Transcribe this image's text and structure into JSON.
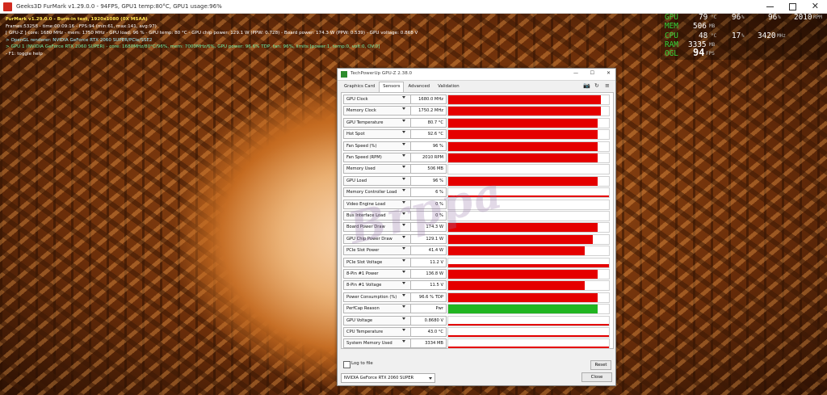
{
  "window": {
    "title": "Geeks3D FurMark v1.29.0.0 - 94FPS, GPU1 temp:80°C, GPU1 usage:96%"
  },
  "overlay": {
    "lines": [
      "FurMark v1.29.0.0 - Burn-in test, 1920x1080 (0X MSAA)",
      "Frames:53258 - time:00:09:16 - FPS:94 (min:61, max:141, avg:97)",
      "[ GPU-Z ] core: 1680 MHz - mem: 1750 MHz - GPU load: 96 % - GPU temp: 80 °C - GPU chip power: 129.1 W (PPW: 0.728) - Board power: 174.3 W (PPW: 0.539) - GPU voltage: 0.868 V",
      "> OpenGL renderer: NVIDIA GeForce RTX 2060 SUPER/PCIe/SSE2",
      "> GPU 1 (NVIDIA GeForce RTX 2060 SUPER) - core: 1680MHz/80°C/96%, mem: 7000MHz/6%, GPU power: 96.6% TDP, fan: 96%, limits:[power:1, temp:0, volt:0, OV:0]",
      "- F1: toggle help"
    ]
  },
  "osd": {
    "rows": [
      {
        "label": "GPU",
        "values": [
          "79",
          "96",
          "96",
          "2010"
        ],
        "units": [
          "°C",
          "%",
          "%",
          "RPM"
        ]
      },
      {
        "label": "MEM",
        "values": [
          "506"
        ],
        "units": [
          "MB"
        ]
      },
      {
        "label": "CPU",
        "values": [
          "48",
          "17",
          "3420"
        ],
        "units": [
          "°C",
          "%",
          "MHz"
        ]
      },
      {
        "label": "RAM",
        "values": [
          "3335"
        ],
        "units": [
          "MB"
        ]
      },
      {
        "label": "OGL",
        "values": [
          "94"
        ],
        "units": [
          "FPS"
        ]
      }
    ]
  },
  "gpuz": {
    "title": "TechPowerUp GPU-Z 2.38.0",
    "tabs": [
      "Graphics Card",
      "Sensors",
      "Advanced",
      "Validation"
    ],
    "active_tab": "Sensors",
    "sensors": [
      {
        "name": "GPU Clock",
        "value": "1680.0 MHz",
        "level": 0.95,
        "color": "#e50000"
      },
      {
        "name": "Memory Clock",
        "value": "1750.2 MHz",
        "level": 0.95,
        "color": "#e50000"
      },
      {
        "name": "GPU Temperature",
        "value": "80.7 °C",
        "level": 0.93,
        "color": "#e50000"
      },
      {
        "name": "Hot Spot",
        "value": "92.6 °C",
        "level": 0.93,
        "color": "#e50000"
      },
      {
        "name": "Fan Speed (%)",
        "value": "96 %",
        "level": 0.93,
        "color": "#e50000"
      },
      {
        "name": "Fan Speed (RPM)",
        "value": "2010 RPM",
        "level": 0.93,
        "color": "#e50000"
      },
      {
        "name": "Memory Used",
        "value": "506 MB",
        "level": 0.0,
        "color": "#e50000"
      },
      {
        "name": "GPU Load",
        "value": "96 %",
        "level": 0.93,
        "color": "#e50000"
      },
      {
        "name": "Memory Controller Load",
        "value": "6 %",
        "level": 0.12,
        "color": "#e50000"
      },
      {
        "name": "Video Engine Load",
        "value": "0 %",
        "level": 0.0,
        "color": "#e50000"
      },
      {
        "name": "Bus Interface Load",
        "value": "0 %",
        "level": 0.0,
        "color": "#e50000"
      },
      {
        "name": "Board Power Draw",
        "value": "174.3 W",
        "level": 0.93,
        "color": "#e50000"
      },
      {
        "name": "GPU Chip Power Draw",
        "value": "129.1 W",
        "level": 0.9,
        "color": "#e50000"
      },
      {
        "name": "PCIe Slot Power",
        "value": "41.4 W",
        "level": 0.85,
        "color": "#e50000"
      },
      {
        "name": "PCIe Slot Voltage",
        "value": "11.2 V",
        "level": 0.25,
        "color": "#e50000"
      },
      {
        "name": "8-Pin #1 Power",
        "value": "136.8 W",
        "level": 0.93,
        "color": "#e50000"
      },
      {
        "name": "8-Pin #1 Voltage",
        "value": "11.5 V",
        "level": 0.85,
        "color": "#e50000"
      },
      {
        "name": "Power Consumption (%)",
        "value": "96.6 % TDP",
        "level": 0.93,
        "color": "#e50000"
      },
      {
        "name": "PerfCap Reason",
        "value": "Pwr",
        "level": 0.93,
        "color": "#21b521"
      },
      {
        "name": "GPU Voltage",
        "value": "0.8680 V",
        "level": 0.12,
        "color": "#e50000"
      },
      {
        "name": "CPU Temperature",
        "value": "43.0 °C",
        "level": 0.08,
        "color": "#e50000"
      },
      {
        "name": "System Memory Used",
        "value": "3334 MB",
        "level": 0.03,
        "color": "#e50000"
      }
    ],
    "log_label": "Log to file",
    "reset_label": "Reset",
    "gpu_select": "NVIDIA GeForce RTX 2060 SUPER",
    "close_label": "Close"
  },
  "watermark": "Brppa"
}
